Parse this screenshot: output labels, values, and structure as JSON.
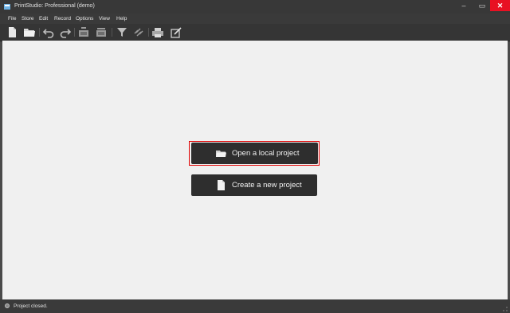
{
  "window": {
    "title": "PrintStudio: Professional (demo)",
    "minimize": "–",
    "maximize": "▭",
    "close": "✕"
  },
  "menu": {
    "items": [
      "File",
      "Store",
      "Edit",
      "Record",
      "Options",
      "View",
      "Help"
    ]
  },
  "toolbar": {
    "icons": [
      "new-file-icon",
      "open-folder-icon",
      "undo-icon",
      "redo-icon",
      "import-icon",
      "export-icon",
      "filter-icon",
      "link-icon",
      "print-icon",
      "edit-form-icon"
    ]
  },
  "main": {
    "open_label": "Open a local project",
    "create_label": "Create a new project"
  },
  "status": {
    "text": "Project closed."
  },
  "colors": {
    "accent_close": "#e81123",
    "focus_ring": "#e00000",
    "button_bg": "#2e2e2e",
    "workspace_bg": "#f0f0f0"
  }
}
